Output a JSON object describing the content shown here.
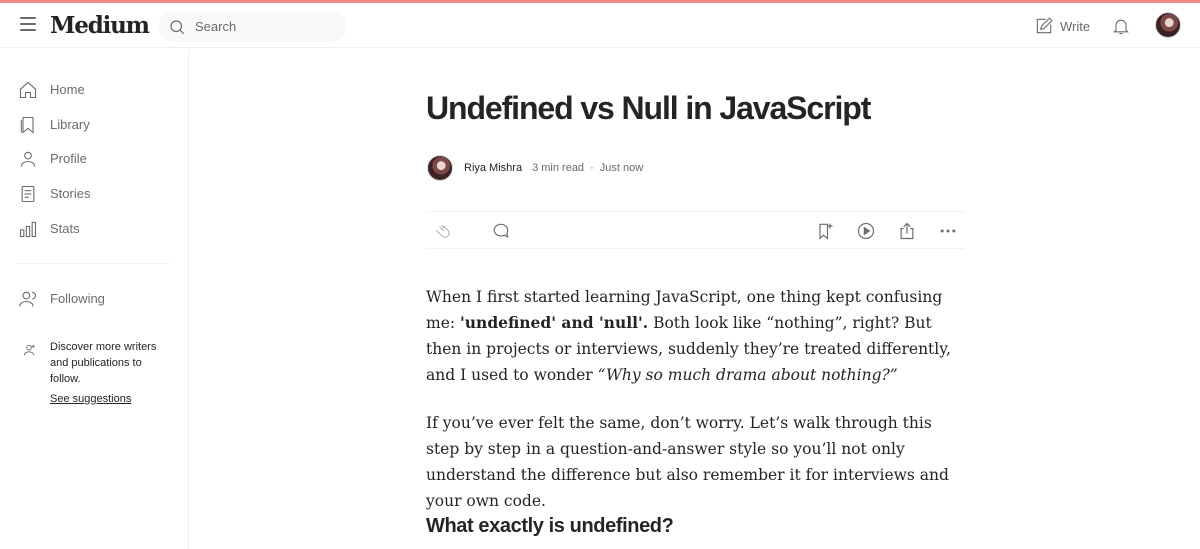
{
  "header": {
    "logo": "Medium",
    "search_placeholder": "Search",
    "write_label": "Write"
  },
  "sidebar": {
    "items": [
      {
        "label": "Home",
        "icon": "home-icon"
      },
      {
        "label": "Library",
        "icon": "bookmark-icon"
      },
      {
        "label": "Profile",
        "icon": "user-icon"
      },
      {
        "label": "Stories",
        "icon": "document-icon"
      },
      {
        "label": "Stats",
        "icon": "bar-chart-icon"
      }
    ],
    "following_label": "Following",
    "discover_text": "Discover more writers and publications to follow.",
    "see_suggestions": "See suggestions"
  },
  "article": {
    "title": "Undefined vs Null in JavaScript",
    "author": "Riya Mishra",
    "read_time": "3 min read",
    "published": "Just now",
    "p1_a": "When I first started learning JavaScript, one thing kept confusing me: ",
    "p1_b": "'undefined' and 'null'.",
    "p1_c": " Both look like “nothing”, right? But then in projects or interviews, suddenly they’re treated differently, and I used to wonder ",
    "p1_d": "“Why so much drama about nothing?”",
    "p2": "If you’ve ever felt the same, don’t worry. Let’s walk through this step by step in a question-and-answer style so you’ll not only understand the difference but also remember it for interviews and your own code.",
    "h2": "What exactly is undefined?"
  },
  "colors": {
    "accent_top": "#f08b8b",
    "text": "#242424",
    "muted": "#6b6b6b"
  }
}
